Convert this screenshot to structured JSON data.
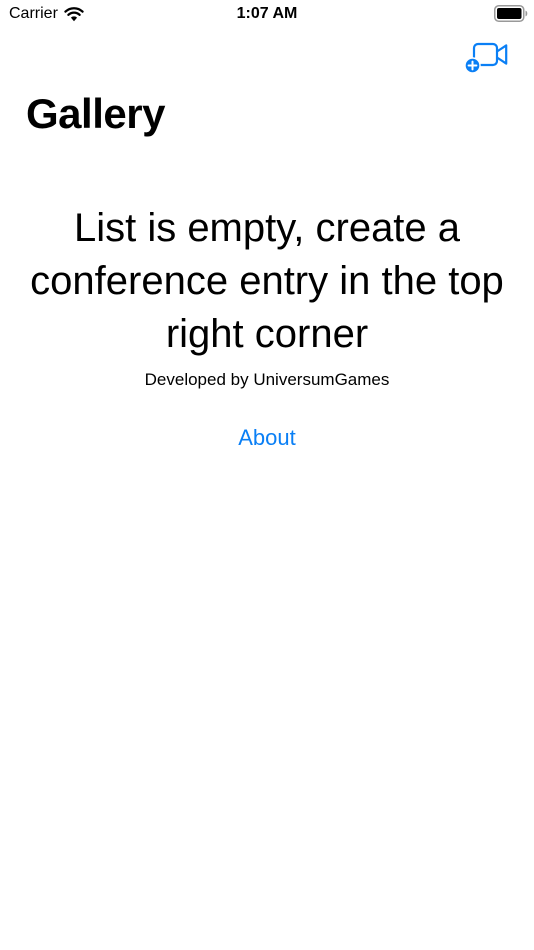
{
  "status_bar": {
    "carrier": "Carrier",
    "time": "1:07 AM"
  },
  "nav": {
    "action_icon": "video-plus-icon"
  },
  "page": {
    "title": "Gallery",
    "empty_message": "List is empty, create a conference entry in the top right corner",
    "credit": "Developed by UniversumGames",
    "about_label": "About"
  },
  "colors": {
    "accent": "#0a7ff5",
    "text": "#000000",
    "background": "#ffffff"
  }
}
